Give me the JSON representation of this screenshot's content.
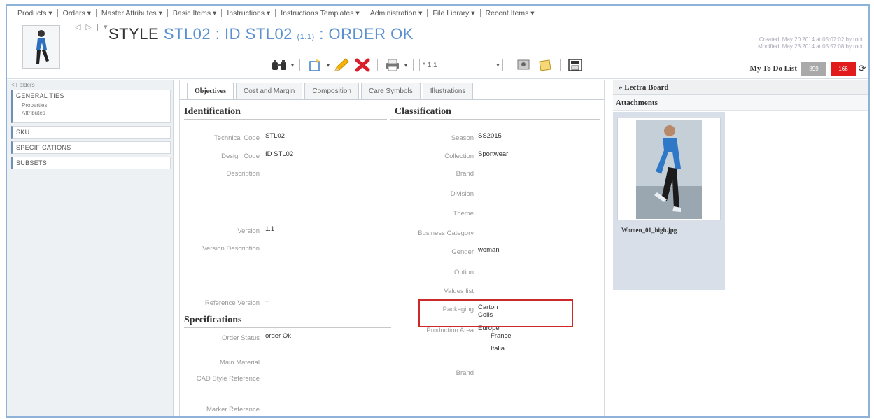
{
  "menu": [
    "Products ▾",
    "Orders ▾",
    "Master Attributes ▾",
    "Basic Items ▾",
    "Instructions ▾",
    "Instructions Templates ▾",
    "Administration ▾",
    "File Library ▾",
    "Recent Items ▾"
  ],
  "header": {
    "nav_arrows": "◁ ▷ | ▾",
    "title_label": "STYLE",
    "title_code": "STL02 : ID STL02",
    "title_version": "(1.1)",
    "title_status": ": ORDER OK",
    "created": "Created: May 20 2014 at 05:07:02 by root",
    "modified": "Modified: May 23 2014 at 05:57:08 by root",
    "version_value": "* 1.1"
  },
  "todo": {
    "label": "My To Do List",
    "count_grey": "899",
    "count_red": "166",
    "grey_color": "#a9a9a9",
    "red_color": "#e11b1b"
  },
  "left_panel": {
    "top_label": "< Folders",
    "sections": [
      {
        "title": "GENERAL TIES",
        "items": [
          "Properties",
          "Attributes"
        ]
      },
      {
        "title": "SKU",
        "items": []
      },
      {
        "title": "SPECIFICATIONS",
        "items": []
      },
      {
        "title": "SUBSETS",
        "items": []
      }
    ]
  },
  "tabs": [
    "Objectives",
    "Cost and Margin",
    "Composition",
    "Care Symbols",
    "Illustrations"
  ],
  "identification": {
    "heading": "Identification",
    "fields": [
      {
        "label": "Technical Code",
        "value": "STL02"
      },
      {
        "label": "Design Code",
        "value": "ID STL02"
      },
      {
        "label": "Description",
        "value": ""
      },
      {
        "label": "Version",
        "value": "1.1"
      },
      {
        "label": "Version Description",
        "value": ""
      },
      {
        "label": "Reference Version",
        "value": "–"
      }
    ]
  },
  "specifications": {
    "heading": "Specifications",
    "fields": [
      {
        "label": "Order Status",
        "value": "order Ok"
      },
      {
        "label": "Main Material",
        "value": ""
      },
      {
        "label": "CAD Style Reference",
        "value": ""
      },
      {
        "label": "Marker Reference",
        "value": ""
      }
    ]
  },
  "classification": {
    "heading": "Classification",
    "fields": [
      {
        "label": "Season",
        "value": "SS2015"
      },
      {
        "label": "Collection",
        "value": "Sportwear"
      },
      {
        "label": "Brand",
        "value": ""
      },
      {
        "label": "Division",
        "value": ""
      },
      {
        "label": "Theme",
        "value": ""
      },
      {
        "label": "Business Category",
        "value": ""
      },
      {
        "label": "Gender",
        "value": "woman"
      },
      {
        "label": "Option",
        "value": ""
      },
      {
        "label": "Values list",
        "value": ""
      },
      {
        "label": "Packaging",
        "value": "Carton",
        "value2": "Colis"
      },
      {
        "label": "Production Area",
        "value": "Europe",
        "value2": "France",
        "value3": "Italia"
      },
      {
        "label": "Brand",
        "value": ""
      }
    ]
  },
  "right_panel": {
    "lectra": "» Lectra Board",
    "attachments": "Attachments",
    "file_name": "Women_01_high.jpg"
  }
}
